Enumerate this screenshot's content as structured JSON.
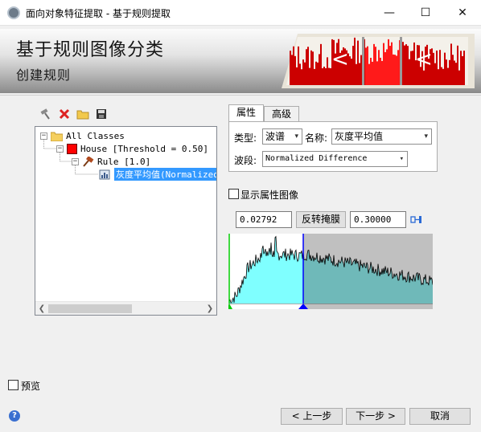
{
  "window": {
    "title": "面向对象特征提取 - 基于规则提取"
  },
  "banner": {
    "title": "基于规则图像分类",
    "subtitle": "创建规则"
  },
  "tree": {
    "root_label": "All Classes",
    "class_label": "House [Threshold = 0.50]",
    "rule_label": "Rule [1.0]",
    "attribute_label": "灰度平均值(Normalized",
    "class_color": "#ff0000"
  },
  "tabs": {
    "properties": "属性",
    "advanced": "高级"
  },
  "properties": {
    "type_label": "类型:",
    "type_value": "波谱",
    "name_label": "名称:",
    "name_value": "灰度平均值",
    "band_label": "波段:",
    "band_value": "Normalized Difference"
  },
  "show_attribute_image_label": "显示属性图像",
  "range": {
    "min_value": "0.02792",
    "max_value": "0.30000",
    "invert_label": "反转掩膜"
  },
  "histogram": {
    "fill_color": "#7fffff",
    "excluded_color": "#c0c0c0",
    "min_marker_color": "#00cc00",
    "max_marker_color": "#0000ff"
  },
  "preview_label": "预览",
  "buttons": {
    "back": "< 上一步",
    "next": "下一步 >",
    "cancel": "取消"
  },
  "icons": [
    "app-icon",
    "minimize-icon",
    "maximize-icon",
    "close-icon",
    "add-rule-icon",
    "delete-icon",
    "open-folder-icon",
    "save-icon",
    "folder-icon",
    "class-color-icon",
    "rule-gavel-icon",
    "attribute-icon",
    "dropdown-caret-icon",
    "lock-range-icon",
    "help-icon"
  ]
}
